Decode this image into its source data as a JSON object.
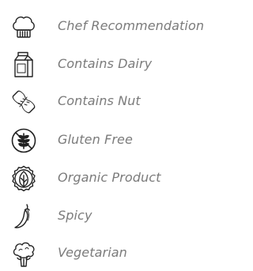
{
  "legend": {
    "items": [
      {
        "icon": "chef-hat-icon",
        "label": "Chef Recommendation"
      },
      {
        "icon": "milk-carton-icon",
        "label": "Contains Dairy"
      },
      {
        "icon": "peanut-icon",
        "label": "Contains Nut"
      },
      {
        "icon": "gluten-free-icon",
        "label": "Gluten Free"
      },
      {
        "icon": "organic-leaf-icon",
        "label": "Organic Product"
      },
      {
        "icon": "chili-pepper-icon",
        "label": "Spicy"
      },
      {
        "icon": "broccoli-icon",
        "label": "Vegetarian"
      }
    ]
  },
  "colors": {
    "icon_stroke": "#222222",
    "label_text": "#7b7b7b"
  }
}
